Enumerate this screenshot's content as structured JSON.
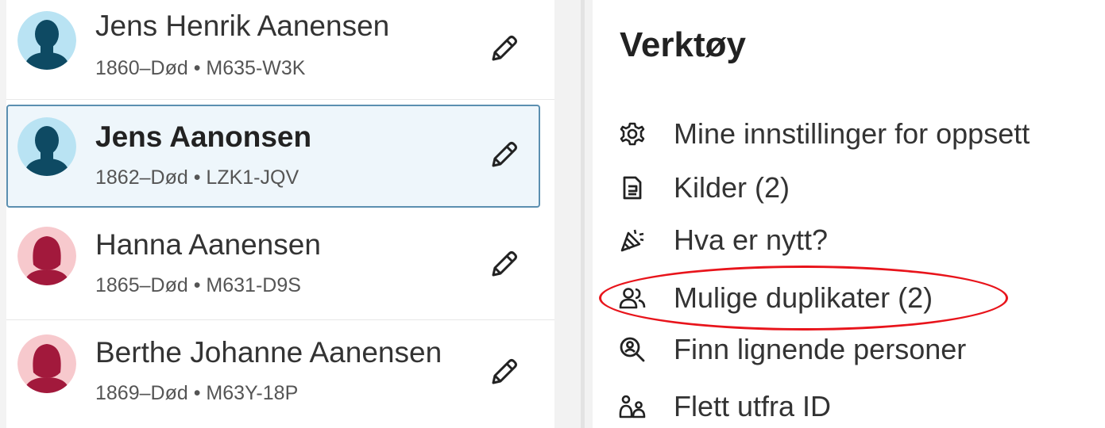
{
  "persons": [
    {
      "name": "Jens Henrik Aanensen",
      "dates": "1860–Død",
      "pid": "M635-W3K",
      "gender": "male",
      "selected": false
    },
    {
      "name": "Jens Aanonsen",
      "dates": "1862–Død",
      "pid": "LZK1-JQV",
      "gender": "male",
      "selected": true
    },
    {
      "name": "Hanna Aanensen",
      "dates": "1865–Død",
      "pid": "M631-D9S",
      "gender": "female",
      "selected": false
    },
    {
      "name": "Berthe Johanne Aanensen",
      "dates": "1869–Død",
      "pid": "M63Y-18P",
      "gender": "female",
      "selected": false
    }
  ],
  "meta_separator": "•",
  "tools": {
    "title": "Verktøy",
    "items": [
      {
        "label": "Mine innstillinger for oppsett",
        "icon": "gear-icon"
      },
      {
        "label": "Kilder (2)",
        "icon": "source-icon"
      },
      {
        "label": "Hva er nytt?",
        "icon": "party-icon"
      },
      {
        "label": "Mulige duplikater (2)",
        "icon": "people-icon"
      },
      {
        "label": "Finn lignende personer",
        "icon": "person-search-icon"
      },
      {
        "label": "Flett utfra ID",
        "icon": "merge-persons-icon"
      }
    ]
  },
  "colors": {
    "male_avatar_bg": "#b9e3f3",
    "male_avatar_fg": "#0e4a63",
    "female_avatar_bg": "#f7c9cd",
    "female_avatar_fg": "#a2193c",
    "highlight": "#e8141b",
    "selected_border": "#5b8fb0",
    "selected_bg": "#eef6fb"
  }
}
